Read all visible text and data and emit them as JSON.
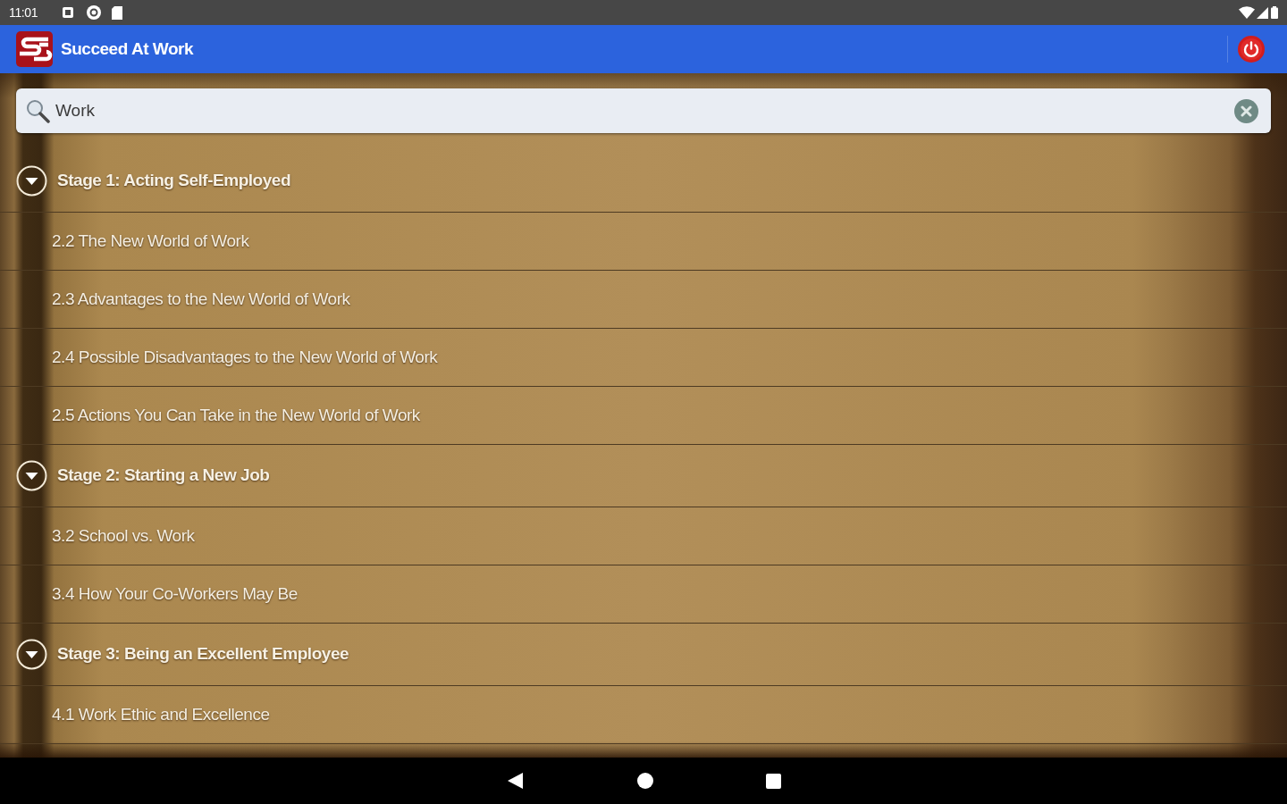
{
  "status_bar": {
    "time": "11:01"
  },
  "app_bar": {
    "title": "Succeed At Work"
  },
  "search": {
    "value": "Work"
  },
  "groups": [
    {
      "title": "Stage 1: Acting Self-Employed",
      "expanded": true,
      "children": [
        {
          "title": "2.2 The New World of Work"
        },
        {
          "title": "2.3 Advantages to the New World of Work"
        },
        {
          "title": "2.4 Possible Disadvantages to the New World of Work"
        },
        {
          "title": "2.5 Actions You Can Take in the New World of Work"
        }
      ]
    },
    {
      "title": "Stage 2: Starting a New Job",
      "expanded": true,
      "children": [
        {
          "title": "3.2 School vs. Work"
        },
        {
          "title": "3.4 How Your Co-Workers May Be"
        }
      ]
    },
    {
      "title": "Stage 3: Being an Excellent Employee",
      "expanded": true,
      "children": [
        {
          "title": "4.1 Work Ethic and Excellence"
        }
      ]
    }
  ]
}
